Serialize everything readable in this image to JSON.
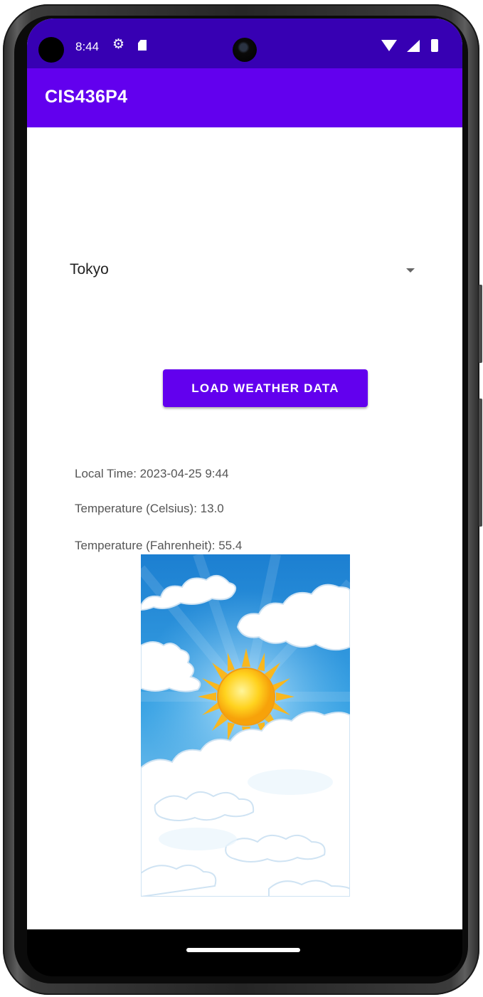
{
  "status_bar": {
    "time": "8:44",
    "icons": [
      "gear-icon",
      "sd-card-icon",
      "wifi-icon",
      "signal-icon",
      "battery-icon"
    ]
  },
  "app_bar": {
    "title": "CIS436P4"
  },
  "city_spinner": {
    "selected": "Tokyo"
  },
  "load_button": {
    "label": "LOAD WEATHER DATA"
  },
  "weather": {
    "local_time": "Local Time: 2023-04-25 9:44",
    "temp_celsius": "Temperature (Celsius): 13.0",
    "temp_fahrenheit": "Temperature (Fahrenheit): 55.4"
  },
  "colors": {
    "status_bar": "#3700b3",
    "app_bar": "#6200ee",
    "button": "#6200ee"
  }
}
